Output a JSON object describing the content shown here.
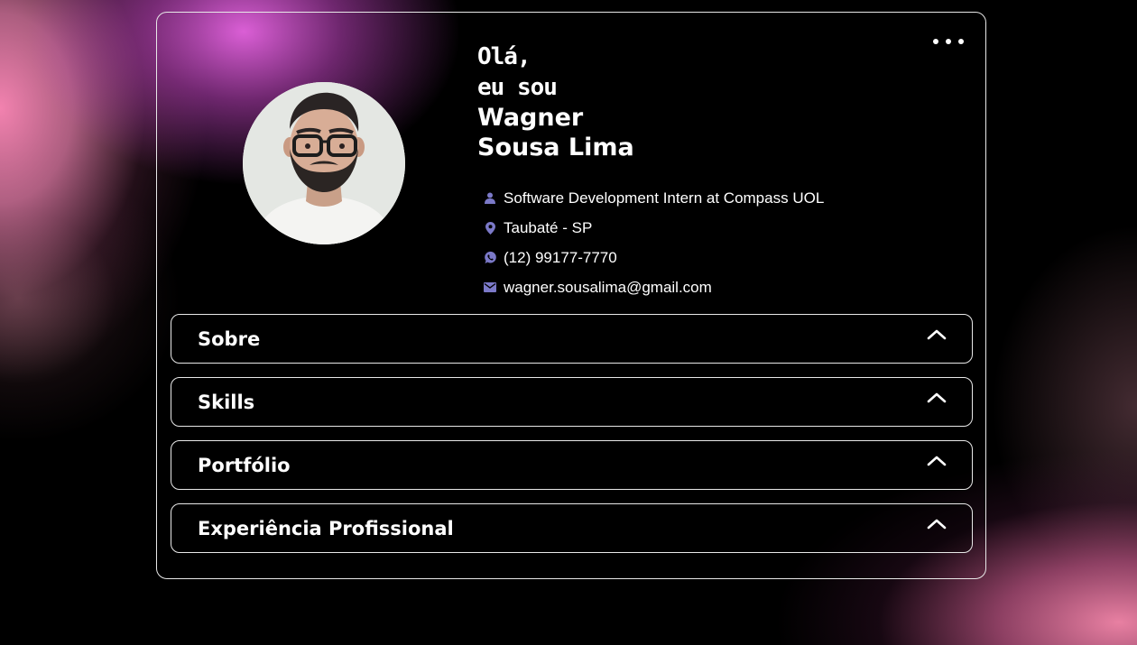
{
  "header": {
    "greeting_line1": "Olá,",
    "greeting_line2": "eu sou",
    "name_line1": "Wagner",
    "name_line2": "Sousa Lima"
  },
  "info": [
    {
      "icon": "person-icon",
      "text": "Software Development Intern at Compass UOL"
    },
    {
      "icon": "location-pin-icon",
      "text": "Taubaté - SP"
    },
    {
      "icon": "whatsapp-icon",
      "text": "(12) 99177-7770"
    },
    {
      "icon": "envelope-icon",
      "text": "wagner.sousalima@gmail.com"
    }
  ],
  "sections": [
    {
      "label": "Sobre",
      "state": "collapsed"
    },
    {
      "label": "Skills",
      "state": "collapsed"
    },
    {
      "label": "Portfólio",
      "state": "collapsed"
    },
    {
      "label": "Experiência Profissional",
      "state": "collapsed"
    }
  ],
  "colors": {
    "accent_icon": "#7b79c8",
    "border": "#e8e8e8",
    "pink_glow": "#e66fe0",
    "rose_glow": "#e880a2"
  }
}
